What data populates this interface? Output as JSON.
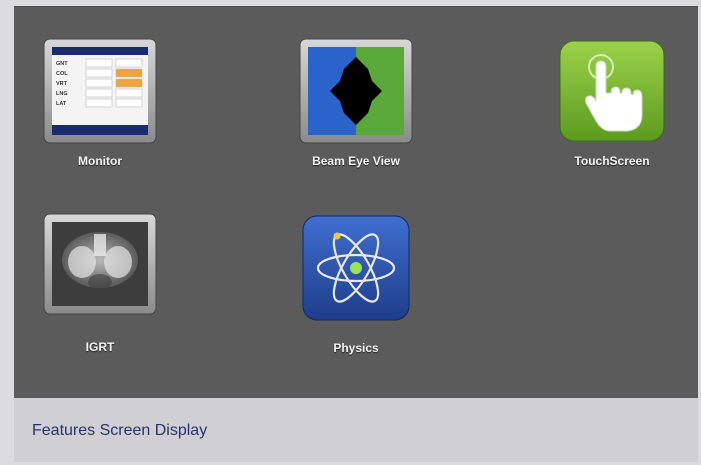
{
  "features": {
    "monitor": {
      "label": "Monitor",
      "rows": [
        "GNT",
        "COL",
        "VRT",
        "LNG",
        "LAT"
      ]
    },
    "beam_eye_view": {
      "label": "Beam Eye View"
    },
    "touchscreen": {
      "label": "TouchScreen"
    },
    "igrt": {
      "label": "IGRT"
    },
    "physics": {
      "label": "Physics"
    }
  },
  "caption": "Features Screen Display",
  "colors": {
    "screen_bg": "#5b5b5b",
    "caption_bg": "#d0cfd3",
    "caption_text": "#27336e",
    "touch_green": "#7bbf2a",
    "physics_blue": "#2c54a6",
    "monitor_header": "#1a2a6e",
    "monitor_highlight": "#f0a23b"
  },
  "icons": [
    "monitor-icon",
    "beam-eye-view-icon",
    "touchscreen-hand-icon",
    "igrt-xray-icon",
    "physics-atom-icon"
  ]
}
